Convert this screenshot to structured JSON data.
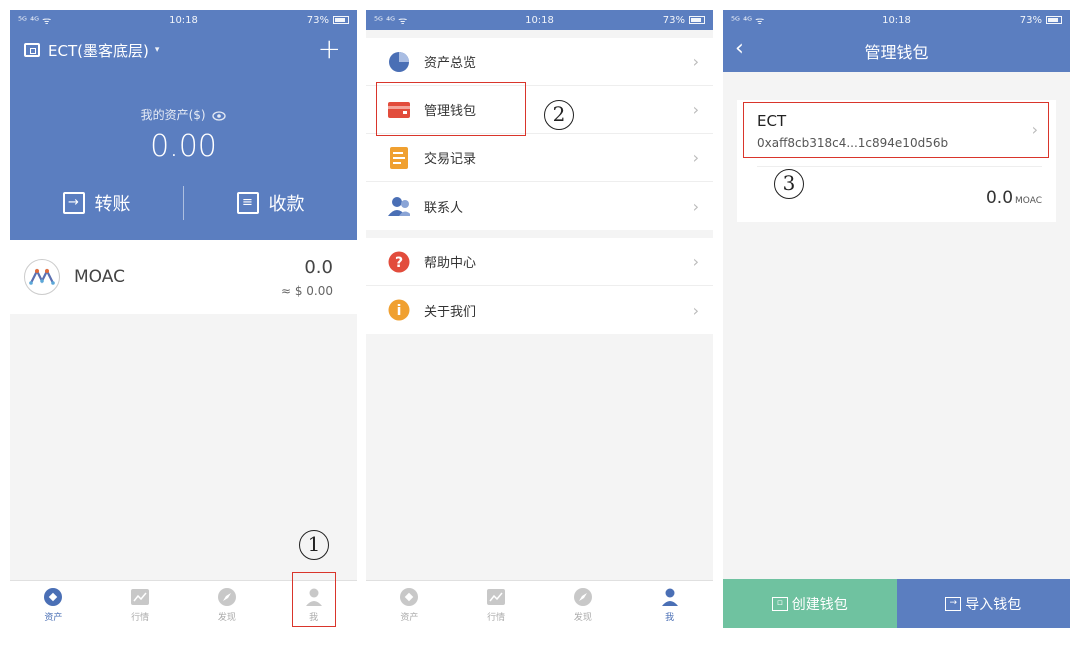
{
  "status": {
    "signal_left": "⁵ᴳ ⁴ᴳ ᯤ",
    "time": "10:18",
    "battery": "73%"
  },
  "screen1": {
    "wallet_name": "ECT(墨客底层)",
    "caret": "▾",
    "add": "+",
    "assets_label": "我的资产($)",
    "assets_value": "0.00",
    "transfer": "转账",
    "receive": "收款",
    "asset": {
      "name": "MOAC",
      "amount": "0.0",
      "usd": "≈ $ 0.00"
    },
    "tabs": [
      "资产",
      "行情",
      "发现",
      "我"
    ]
  },
  "screen2": {
    "group1": [
      "资产总览",
      "管理钱包",
      "交易记录",
      "联系人"
    ],
    "group2": [
      "帮助中心",
      "关于我们"
    ],
    "chevron": "›",
    "tabs": [
      "资产",
      "行情",
      "发现",
      "我"
    ]
  },
  "screen3": {
    "title": "管理钱包",
    "back": "‹",
    "wallet": {
      "name": "ECT",
      "address": "0xaff8cb318c4...1c894e10d56b",
      "balance": "0.0",
      "unit": "MOAC"
    },
    "create": "创建钱包",
    "import": "导入钱包"
  },
  "annotations": [
    "1",
    "2",
    "3"
  ],
  "colors": {
    "primary": "#5b7ec0",
    "green": "#6fc2a0",
    "annotation": "#d9352b"
  }
}
